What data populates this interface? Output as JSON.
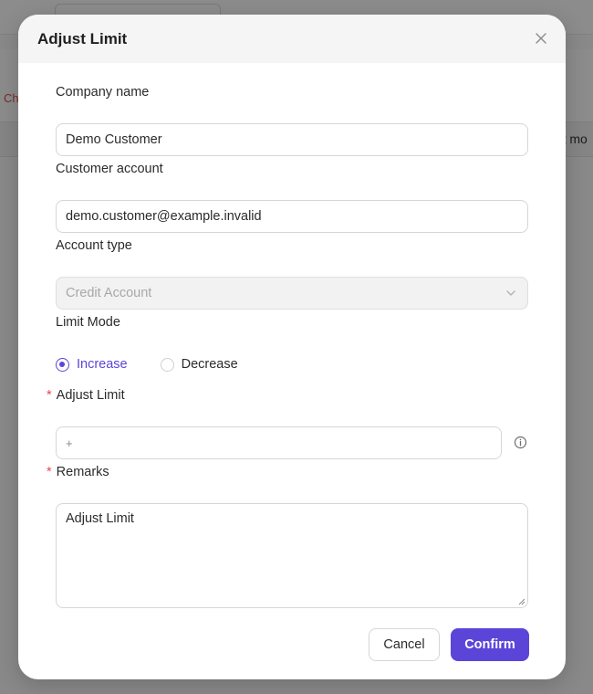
{
  "background": {
    "side_text": "Ch",
    "column_header": "Last mo"
  },
  "dialog": {
    "title": "Adjust Limit",
    "close_icon": "close-icon"
  },
  "form": {
    "company_name": {
      "label": "Company name",
      "value": "Demo Customer"
    },
    "customer_account": {
      "label": "Customer account",
      "value": "demo.customer@example.invalid"
    },
    "account_type": {
      "label": "Account type",
      "value": "Credit Account",
      "icon": "chevron-down-icon"
    },
    "limit_mode": {
      "label": "Limit Mode",
      "options": [
        "Increase",
        "Decrease"
      ],
      "selected": "Increase"
    },
    "adjust_limit": {
      "label": "Adjust Limit",
      "required_mark": "*",
      "prefix": "+",
      "value": "",
      "info_icon": "info-icon"
    },
    "remarks": {
      "label": "Remarks",
      "required_mark": "*",
      "value": "Adjust Limit"
    }
  },
  "actions": {
    "cancel_label": "Cancel",
    "confirm_label": "Confirm"
  },
  "colors": {
    "accent": "#5b45d9",
    "required": "#e5484d"
  }
}
